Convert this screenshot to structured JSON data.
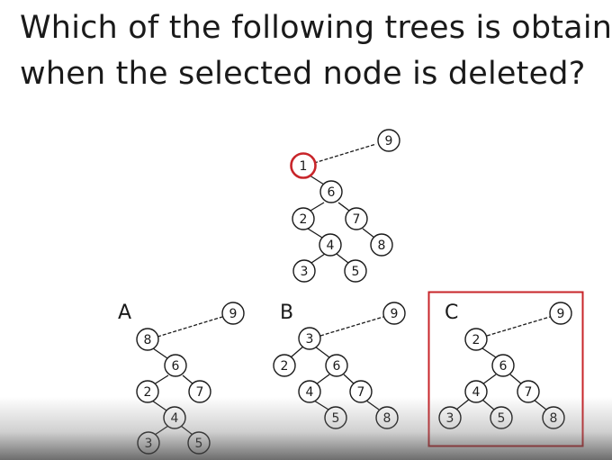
{
  "question": {
    "line1": "Which of the following trees is obtained",
    "line2": "when the selected node is deleted?"
  },
  "colors": {
    "text": "#1a1a1a",
    "selected_highlight": "#c8252a",
    "answer_box": "#c8252a"
  },
  "original_tree": {
    "selected_node": "1",
    "nodes": [
      "9",
      "1",
      "6",
      "2",
      "7",
      "4",
      "8",
      "3",
      "5"
    ]
  },
  "options": [
    {
      "label": "A",
      "nodes": [
        "9",
        "8",
        "6",
        "2",
        "7",
        "4",
        "3",
        "5"
      ],
      "highlighted": false
    },
    {
      "label": "B",
      "nodes": [
        "9",
        "3",
        "2",
        "6",
        "4",
        "7",
        "5",
        "8"
      ],
      "highlighted": false
    },
    {
      "label": "C",
      "nodes": [
        "9",
        "2",
        "6",
        "4",
        "7",
        "3",
        "5",
        "8"
      ],
      "highlighted": true
    }
  ]
}
